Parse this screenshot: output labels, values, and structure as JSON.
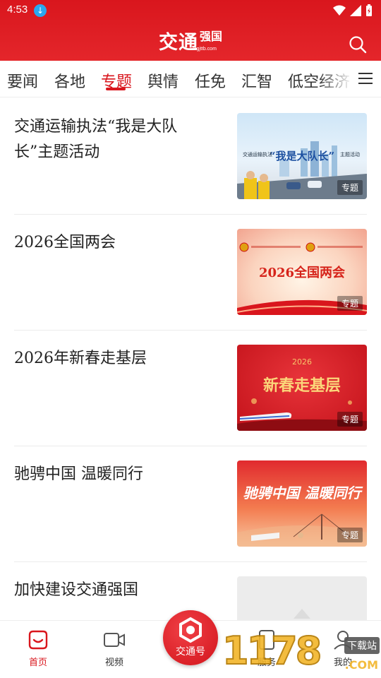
{
  "status_bar": {
    "time": "4:53"
  },
  "header": {
    "logo_main": "交通",
    "logo_sub": "强国",
    "logo_small": "zgjttb.com"
  },
  "tabs": [
    {
      "label": "要闻"
    },
    {
      "label": "各地"
    },
    {
      "label": "专题",
      "active": true
    },
    {
      "label": "舆情"
    },
    {
      "label": "任免"
    },
    {
      "label": "汇智"
    },
    {
      "label": "低空经济"
    }
  ],
  "articles": [
    {
      "title": "交通运输执法“我是大队长”主题活动",
      "thumb_text": "“我是大队长”",
      "thumb_caption": "交通运输执法",
      "thumb_suffix": "主题活动",
      "tag": "专题"
    },
    {
      "title": "2026全国两会",
      "thumb_text": "2026全国两会",
      "tag": "专题"
    },
    {
      "title": "2026年新春走基层",
      "thumb_text": "新春走基层",
      "thumb_year": "2026",
      "tag": "专题"
    },
    {
      "title": "驰骋中国  温暖同行",
      "thumb_text": "驰骋中国 温暖同行",
      "tag": "专题"
    },
    {
      "title": "加快建设交通强国",
      "tag": ""
    }
  ],
  "bottom_nav": {
    "home": "首页",
    "video": "视频",
    "center": "交通号",
    "service": "服务",
    "mine": "我的"
  },
  "watermark": {
    "digits": "1178",
    "badge": "下载站",
    "suffix": ".COM"
  },
  "colors": {
    "brand_red": "#d9161d",
    "tab_active": "#d9161d"
  }
}
